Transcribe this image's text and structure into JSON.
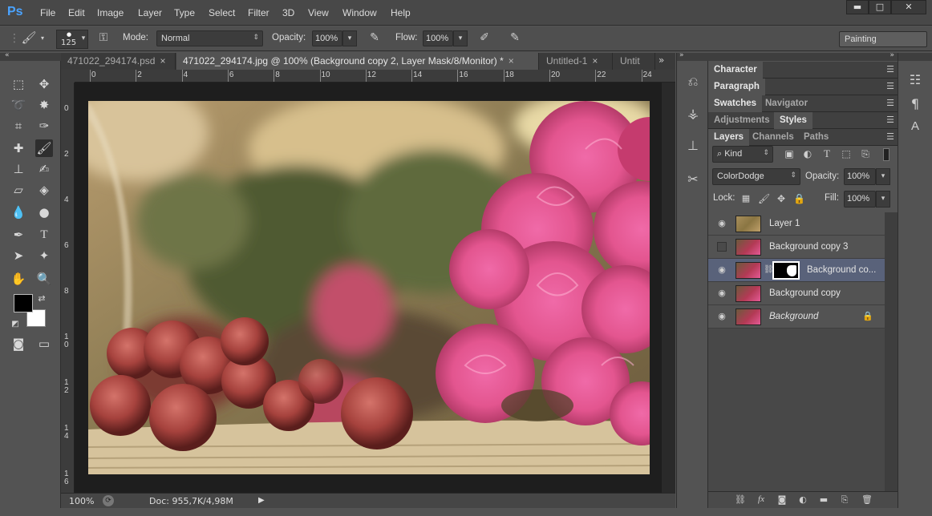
{
  "app": {
    "logo": "Ps",
    "workspace": "Painting"
  },
  "menu": [
    "File",
    "Edit",
    "Image",
    "Layer",
    "Type",
    "Select",
    "Filter",
    "3D",
    "View",
    "Window",
    "Help"
  ],
  "window_controls": {
    "minimize": "▬",
    "maximize": "□",
    "close": "✕"
  },
  "options": {
    "brush_size": "125",
    "mode_label": "Mode:",
    "mode_value": "Normal",
    "opacity_label": "Opacity:",
    "opacity_value": "100%",
    "flow_label": "Flow:",
    "flow_value": "100%"
  },
  "tabs": [
    {
      "label": "471022_294174.psd",
      "close": "×",
      "active": false
    },
    {
      "label": "471022_294174.jpg @ 100% (Background copy 2, Layer Mask/8/Monitor) *",
      "close": "×",
      "active": true
    },
    {
      "label": "Untitled-1",
      "close": "×",
      "active": false
    },
    {
      "label": "Untit",
      "close": "",
      "active": false
    }
  ],
  "tabs_overflow": "»",
  "ruler_top": [
    "0",
    "2",
    "4",
    "6",
    "8",
    "10",
    "12",
    "14",
    "16",
    "18",
    "20",
    "22",
    "24"
  ],
  "ruler_left": [
    "0",
    "2",
    "4",
    "6",
    "8",
    "1\n0",
    "1\n2",
    "1\n4",
    "1\n6"
  ],
  "status": {
    "zoom": "100%",
    "doc": "Doc: 955,7K/4,98M"
  },
  "panel_groups": {
    "group1": [
      "Character"
    ],
    "group2": [
      "Paragraph"
    ],
    "group3": [
      "Swatches",
      "Navigator"
    ],
    "group4": [
      "Adjustments",
      "Styles"
    ],
    "group5": [
      "Layers",
      "Channels",
      "Paths"
    ]
  },
  "layers_panel": {
    "kind_label": "Kind",
    "blend_mode": "ColorDodge",
    "opacity_label": "Opacity:",
    "opacity_value": "100%",
    "lock_label": "Lock:",
    "fill_label": "Fill:",
    "fill_value": "100%",
    "layers": [
      {
        "name": "Layer 1",
        "visible": true,
        "selected": false,
        "mask": false,
        "locked": false,
        "italic": false
      },
      {
        "name": "Background copy 3",
        "visible": false,
        "selected": false,
        "mask": false,
        "locked": false,
        "italic": false
      },
      {
        "name": "Background co...",
        "visible": true,
        "selected": true,
        "mask": true,
        "locked": false,
        "italic": false
      },
      {
        "name": "Background copy",
        "visible": true,
        "selected": false,
        "mask": false,
        "locked": false,
        "italic": false
      },
      {
        "name": "Background",
        "visible": true,
        "selected": false,
        "mask": false,
        "locked": true,
        "italic": true
      }
    ]
  },
  "colors": {
    "accent": "#4aa3ff",
    "selected_layer": "#59627a",
    "foreground": "#000000",
    "background": "#ffffff"
  }
}
